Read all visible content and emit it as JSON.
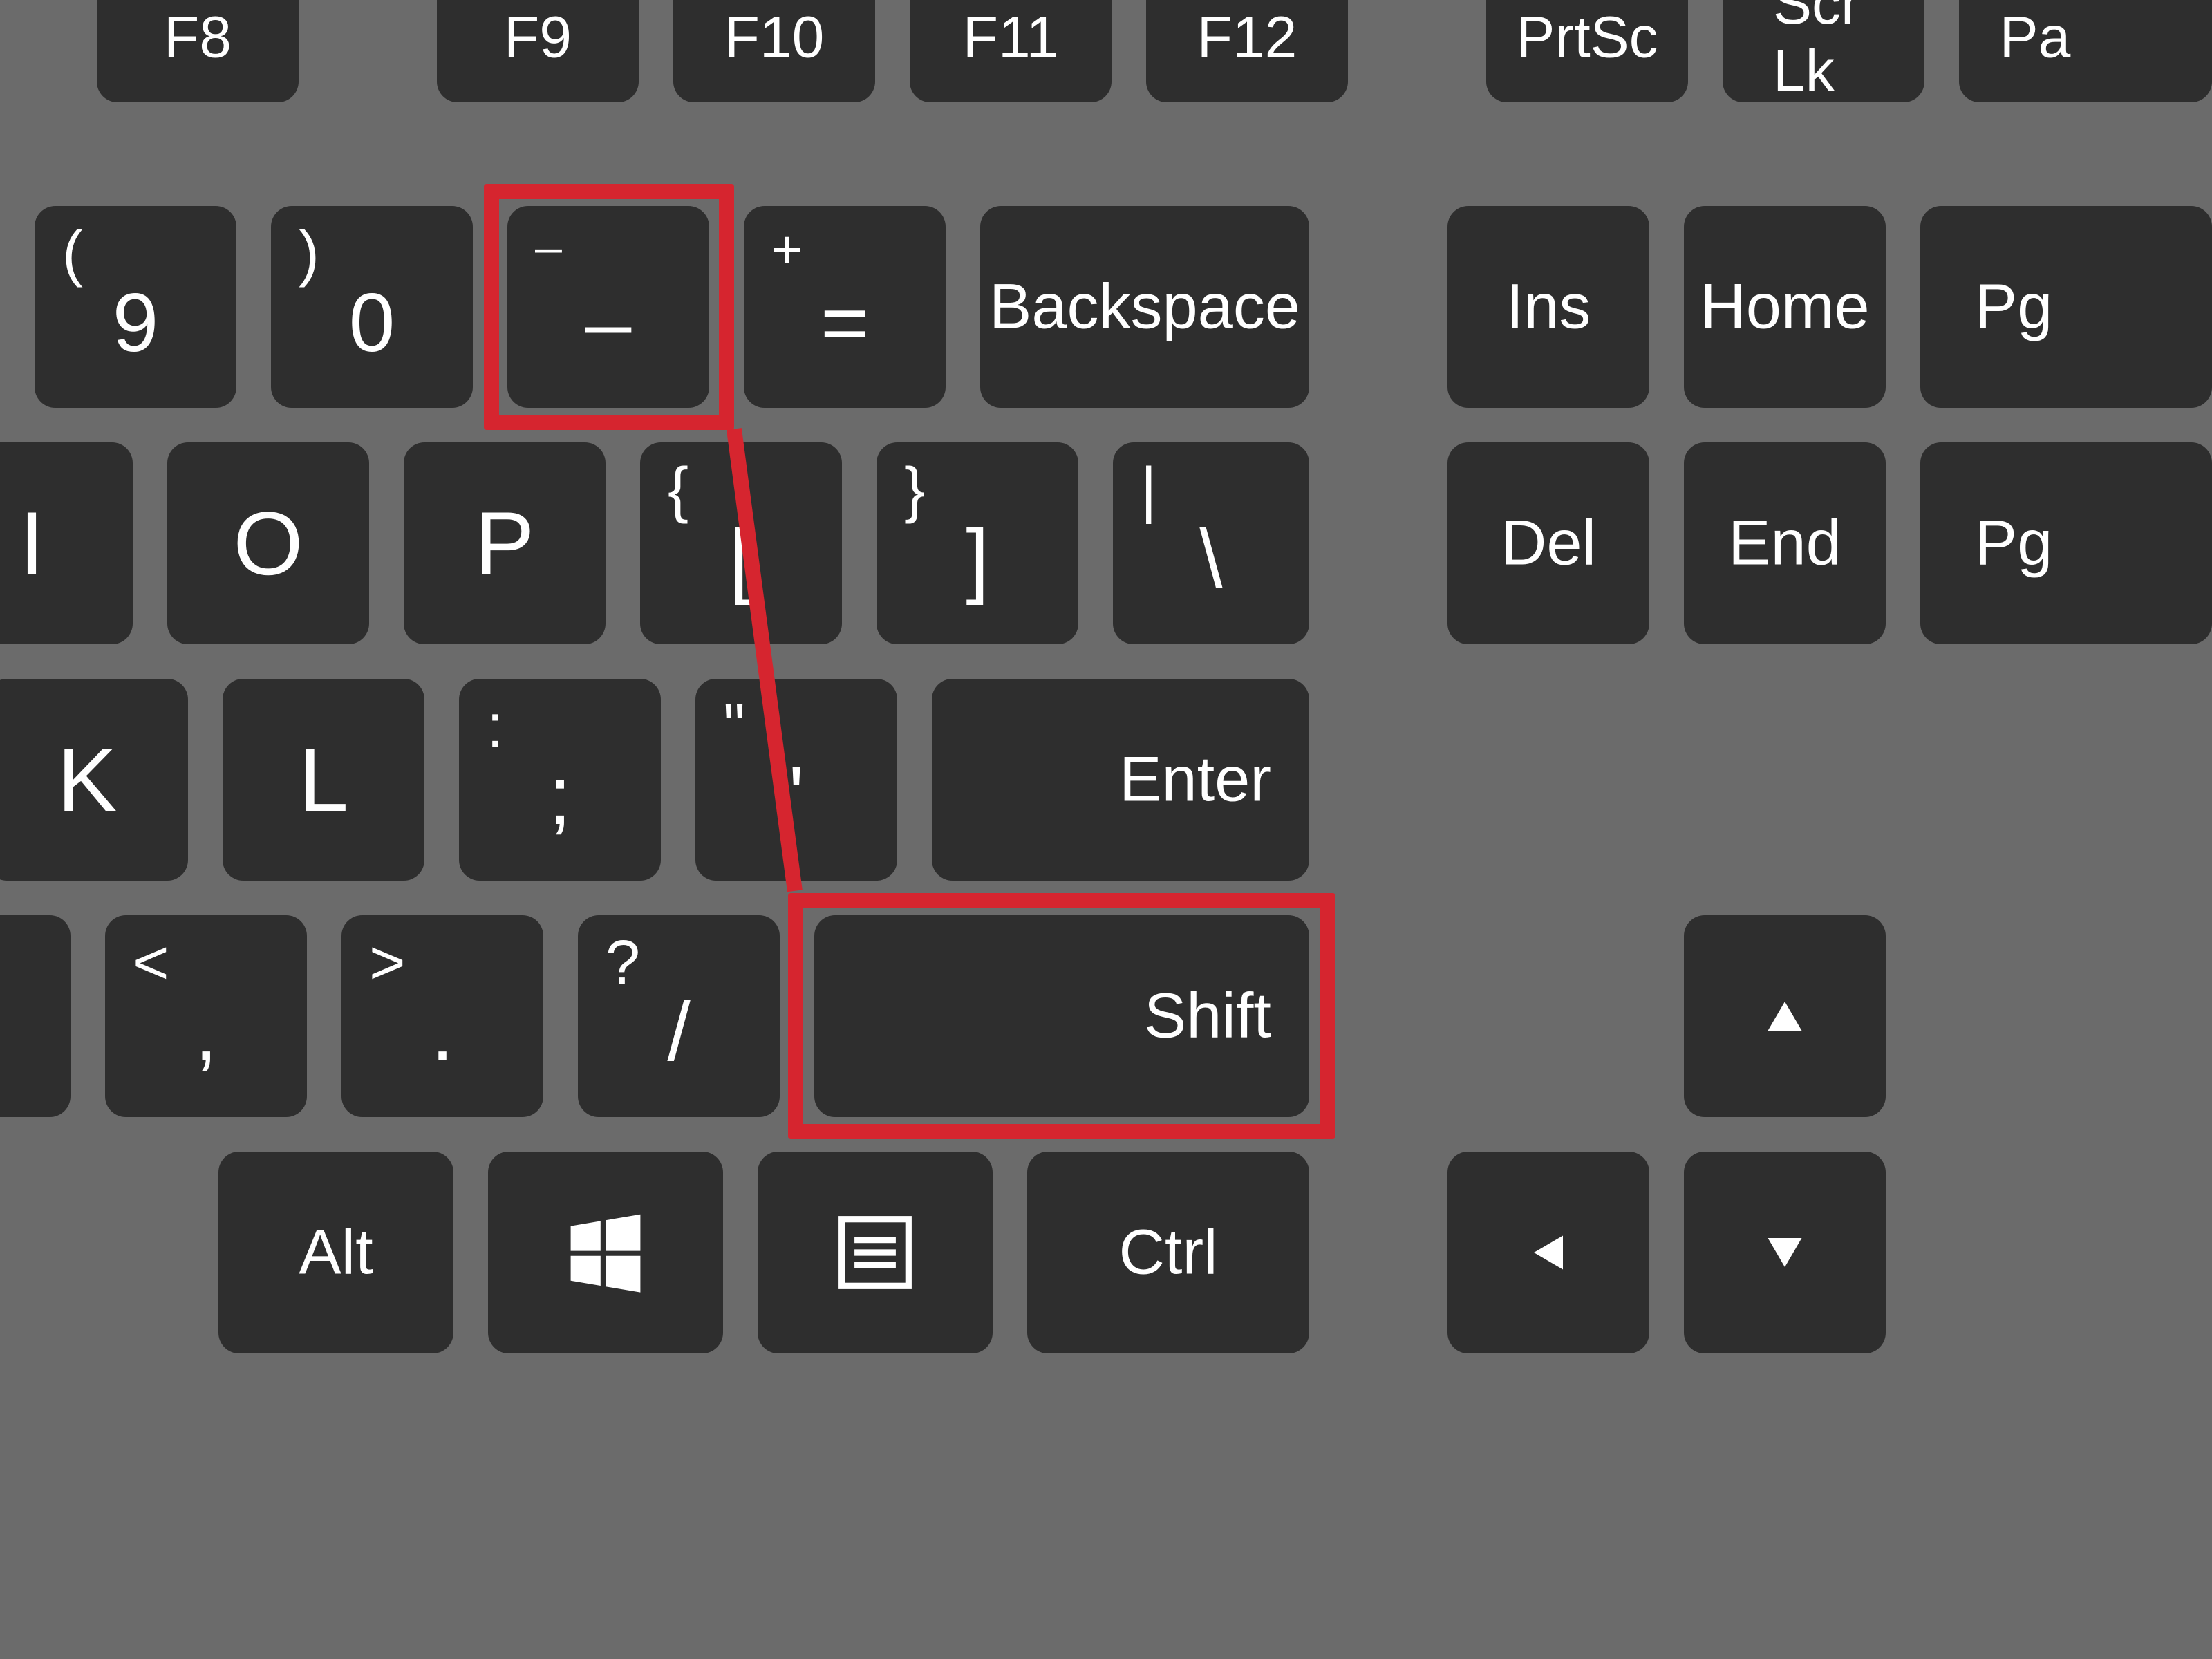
{
  "highlight_color": "#d6252f",
  "key_bg": "#2e2e2e",
  "board_bg": "#6b6b6b",
  "row_fn": {
    "f8": "F8",
    "f9": "F9",
    "f10": "F10",
    "f11": "F11",
    "f12": "F12",
    "prtsc": "PrtSc",
    "scrlk": "Scr Lk",
    "pause_partial": "Pa"
  },
  "row_numbers": {
    "nine": {
      "upper": "(",
      "lower": "9"
    },
    "zero": {
      "upper": ")",
      "lower": "0"
    },
    "minus": {
      "upper": "–",
      "lower": "–"
    },
    "equals": {
      "upper": "+",
      "lower": "="
    },
    "backspace": "Backspace",
    "ins": "Ins",
    "home": "Home",
    "pgup_partial": "Pg"
  },
  "row_qwerty": {
    "i": "I",
    "o": "O",
    "p": "P",
    "bracket_l": {
      "upper": "{",
      "lower": "["
    },
    "bracket_r": {
      "upper": "}",
      "lower": "]"
    },
    "backslash": {
      "upper": "|",
      "lower": "\\"
    },
    "del": "Del",
    "end": "End",
    "pgdn_partial": "Pg"
  },
  "row_home": {
    "k": "K",
    "l": "L",
    "semicolon": {
      "upper": ":",
      "lower": ";"
    },
    "quote": {
      "upper": "\"",
      "lower": "'"
    },
    "enter": "Enter"
  },
  "row_shift": {
    "m_partial": "",
    "comma": {
      "upper": "<",
      "lower": ","
    },
    "period": {
      "upper": ">",
      "lower": "."
    },
    "slash": {
      "upper": "?",
      "lower": "/"
    },
    "shift": "Shift"
  },
  "row_bottom": {
    "alt": "Alt",
    "win_icon": "windows",
    "menu_icon": "menu",
    "ctrl": "Ctrl"
  },
  "arrows": {
    "up": "up",
    "left": "left",
    "down": "down"
  },
  "annotation": {
    "highlighted_keys": [
      "minus",
      "shift"
    ],
    "meaning": "Shift plus Minus key combination"
  }
}
